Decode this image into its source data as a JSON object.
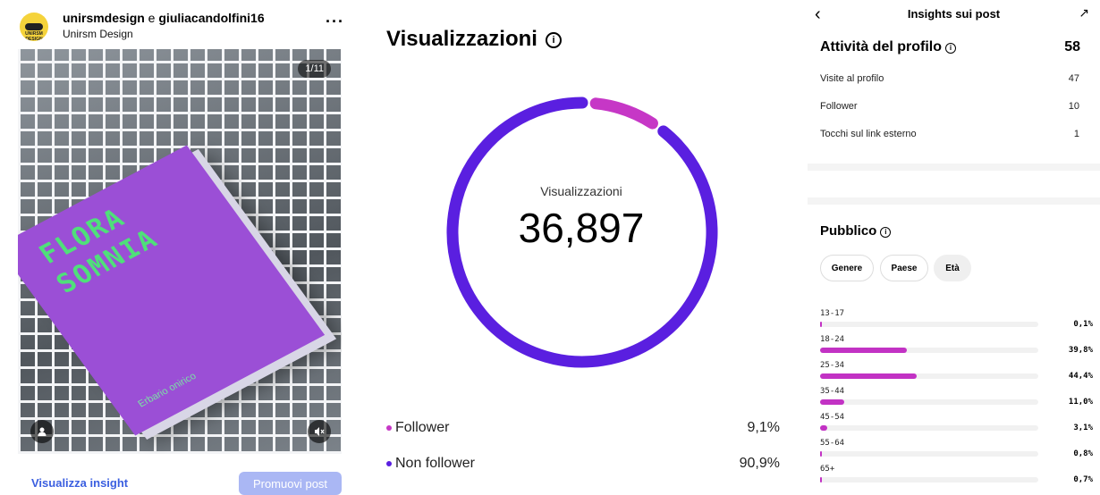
{
  "post": {
    "usernames_a": "unirsmdesign",
    "usernames_join": " e ",
    "usernames_b": "giuliacandolfini16",
    "account_name": "Unirsm Design",
    "avatar_text": "UNIRSM DESIGN",
    "more_label": "···",
    "book_line1": "FLORA",
    "book_line2": "SOMNIA",
    "book_author": "Erbario onirico",
    "counter": "1/11",
    "view_insights": "Visualizza insight",
    "promote": "Promuovi post"
  },
  "views": {
    "title": "Visualizzazioni",
    "info_icon": "i",
    "center_label": "Visualizzazioni",
    "total": "36,897",
    "legend": [
      {
        "label": "Follower",
        "pct": "9,1%",
        "value": 9.1,
        "color": "#c637c6"
      },
      {
        "label": "Non follower",
        "pct": "90,9%",
        "value": 90.9,
        "color": "#5a1fe0"
      }
    ]
  },
  "chart_data": {
    "type": "pie",
    "title": "Visualizzazioni",
    "categories": [
      "Follower",
      "Non follower"
    ],
    "values": [
      9.1,
      90.9
    ],
    "colors": [
      "#c637c6",
      "#5a1fe0"
    ]
  },
  "insights": {
    "title": "Insights sui post",
    "back_icon": "‹",
    "trend_icon": "↗",
    "activity_title": "Attività del profilo",
    "activity_total": "58",
    "rows": [
      {
        "label": "Visite al profilo",
        "value": "47"
      },
      {
        "label": "Follower",
        "value": "10"
      },
      {
        "label": "Tocchi sul link esterno",
        "value": "1"
      }
    ],
    "audience_title": "Pubblico",
    "chips": [
      "Genere",
      "Paese",
      "Età"
    ],
    "ages": [
      {
        "label": "13-17",
        "pct": "0,1%",
        "value": 0.1
      },
      {
        "label": "18-24",
        "pct": "39,8%",
        "value": 39.8
      },
      {
        "label": "25-34",
        "pct": "44,4%",
        "value": 44.4
      },
      {
        "label": "35-44",
        "pct": "11,0%",
        "value": 11.0
      },
      {
        "label": "45-54",
        "pct": "3,1%",
        "value": 3.1
      },
      {
        "label": "55-64",
        "pct": "0,8%",
        "value": 0.8
      },
      {
        "label": "65+",
        "pct": "0,7%",
        "value": 0.7
      }
    ]
  }
}
